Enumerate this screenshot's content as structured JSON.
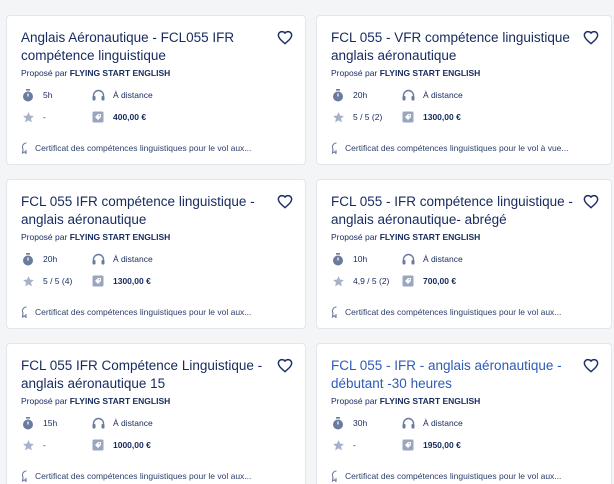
{
  "labels": {
    "provider_prefix": "Proposé par"
  },
  "cards": [
    {
      "title": "Anglais Aéronautique - FCL055 IFR compétence linguistique",
      "provider": "FLYING START ENGLISH",
      "duration": "5h",
      "mode": "À distance",
      "rating": "-",
      "price": "400,00 €",
      "certificate": "Certificat des compétences linguistiques pour le vol aux..."
    },
    {
      "title": "FCL 055 - VFR compétence linguistique anglais aéronautique",
      "provider": "FLYING START ENGLISH",
      "duration": "20h",
      "mode": "À distance",
      "rating": "5 / 5 (2)",
      "price": "1300,00 €",
      "certificate": "Certificat des compétences linguistiques pour le vol à vue..."
    },
    {
      "title": "FCL 055 IFR compétence linguistique - anglais aéronautique",
      "provider": "FLYING START ENGLISH",
      "duration": "20h",
      "mode": "À distance",
      "rating": "5 / 5 (4)",
      "price": "1300,00 €",
      "certificate": "Certificat des compétences linguistiques pour le vol aux..."
    },
    {
      "title": "FCL 055 - IFR compétence linguistique - anglais aéronautique- abrégé",
      "provider": "FLYING START ENGLISH",
      "duration": "10h",
      "mode": "À distance",
      "rating": "4,9 / 5 (2)",
      "price": "700,00 €",
      "certificate": "Certificat des compétences linguistiques pour le vol aux..."
    },
    {
      "title": "FCL 055 IFR Compétence Linguistique - anglais aéronautique 15",
      "provider": "FLYING START ENGLISH",
      "duration": "15h",
      "mode": "À distance",
      "rating": "-",
      "price": "1000,00 €",
      "certificate": "Certificat des compétences linguistiques pour le vol aux..."
    },
    {
      "title": "FCL 055 - IFR - anglais aéronautique - débutant -30 heures",
      "title_style": "link",
      "provider": "FLYING START ENGLISH",
      "duration": "30h",
      "mode": "À distance",
      "rating": "-",
      "price": "1950,00 €",
      "certificate": "Certificat des compétences linguistiques pour le vol aux..."
    }
  ],
  "icons": {
    "favorite": "heart-outline-icon",
    "duration": "stopwatch-icon",
    "mode": "headphones-icon",
    "rating": "star-icon",
    "price": "price-tag-icon",
    "certificate": "certificate-ribbon-icon"
  },
  "colors": {
    "text": "#162a5e",
    "link": "#2d5bb6",
    "icon": "#6b7b9e",
    "star": "#a7b1c9",
    "background": "#f4f5f7",
    "card": "#ffffff",
    "border": "#e2e6ee"
  }
}
